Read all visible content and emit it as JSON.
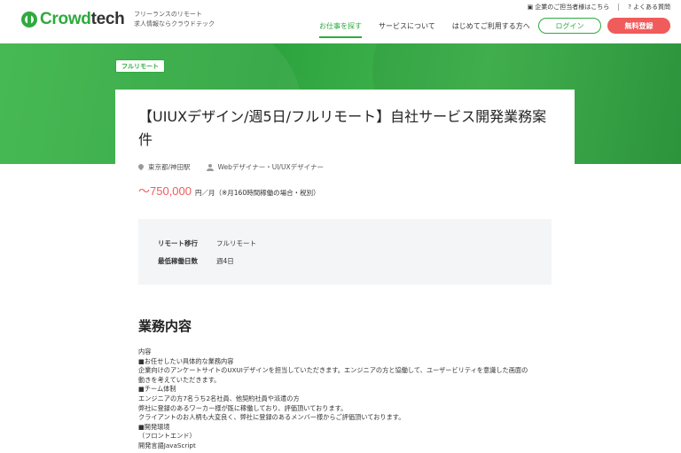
{
  "header": {
    "logo_prefix": "Crowd",
    "logo_suffix": "tech",
    "tagline_line1": "フリーランスのリモート",
    "tagline_line2": "求人情報ならクラウドテック",
    "top_links": [
      "企業のご担当者様はこちら",
      "よくある質問"
    ],
    "nav": [
      "お仕事を探す",
      "サービスについて",
      "はじめてご利用する方へ"
    ],
    "login_label": "ログイン",
    "register_label": "無料登録"
  },
  "job": {
    "badge": "フルリモート",
    "title": "【UIUXデザイン/週5日/フルリモート】自社サービス開発業務案件",
    "location": "東京都/神田駅",
    "role": "Webデザイナー・UI/UXデザイナー",
    "salary_amount": "〜750,000",
    "salary_unit": "円／月（※月160時間稼働の場合・税別）",
    "conditions": [
      {
        "key": "リモート移行",
        "value": "フルリモート"
      },
      {
        "key": "最低稼働日数",
        "value": "週4日"
      }
    ],
    "section_title": "業務内容",
    "description_lines": [
      "内容",
      "■お任せしたい具体的な業務内容",
      "企業向けのアンケートサイトのUXUIデザインを担当していただきます。エンジニアの方と協働して、ユーザービリティを意識した画面の",
      "動きを考えていただきます。",
      "■チーム体制",
      "エンジニアの方7名うち2名社員、他契約社員や派遣の方",
      "弊社に登録のあるワーカー様が既に稼働しており、評価頂いております。",
      "クライアントのお人柄も大変良く、弊社に登録のあるメンバー様からご評価頂いております。",
      "■開発環境",
      "（フロントエンド）",
      "開発言語JavaScript"
    ]
  },
  "colors": {
    "brand_green": "#2eaa3f",
    "register_red": "#f05b5b",
    "salary_red": "#f05b5b"
  },
  "icons": [
    "location-pin-icon",
    "user-icon",
    "building-icon",
    "question-icon"
  ]
}
